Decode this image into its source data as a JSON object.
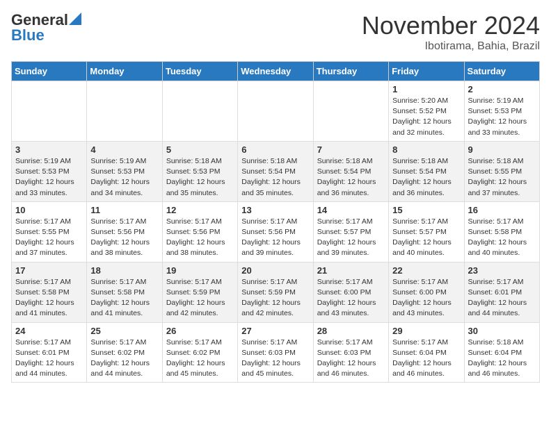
{
  "header": {
    "logo_line1": "General",
    "logo_line2": "Blue",
    "month": "November 2024",
    "location": "Ibotirama, Bahia, Brazil"
  },
  "weekdays": [
    "Sunday",
    "Monday",
    "Tuesday",
    "Wednesday",
    "Thursday",
    "Friday",
    "Saturday"
  ],
  "weeks": [
    [
      {
        "day": "",
        "info": ""
      },
      {
        "day": "",
        "info": ""
      },
      {
        "day": "",
        "info": ""
      },
      {
        "day": "",
        "info": ""
      },
      {
        "day": "",
        "info": ""
      },
      {
        "day": "1",
        "info": "Sunrise: 5:20 AM\nSunset: 5:52 PM\nDaylight: 12 hours\nand 32 minutes."
      },
      {
        "day": "2",
        "info": "Sunrise: 5:19 AM\nSunset: 5:53 PM\nDaylight: 12 hours\nand 33 minutes."
      }
    ],
    [
      {
        "day": "3",
        "info": "Sunrise: 5:19 AM\nSunset: 5:53 PM\nDaylight: 12 hours\nand 33 minutes."
      },
      {
        "day": "4",
        "info": "Sunrise: 5:19 AM\nSunset: 5:53 PM\nDaylight: 12 hours\nand 34 minutes."
      },
      {
        "day": "5",
        "info": "Sunrise: 5:18 AM\nSunset: 5:53 PM\nDaylight: 12 hours\nand 35 minutes."
      },
      {
        "day": "6",
        "info": "Sunrise: 5:18 AM\nSunset: 5:54 PM\nDaylight: 12 hours\nand 35 minutes."
      },
      {
        "day": "7",
        "info": "Sunrise: 5:18 AM\nSunset: 5:54 PM\nDaylight: 12 hours\nand 36 minutes."
      },
      {
        "day": "8",
        "info": "Sunrise: 5:18 AM\nSunset: 5:54 PM\nDaylight: 12 hours\nand 36 minutes."
      },
      {
        "day": "9",
        "info": "Sunrise: 5:18 AM\nSunset: 5:55 PM\nDaylight: 12 hours\nand 37 minutes."
      }
    ],
    [
      {
        "day": "10",
        "info": "Sunrise: 5:17 AM\nSunset: 5:55 PM\nDaylight: 12 hours\nand 37 minutes."
      },
      {
        "day": "11",
        "info": "Sunrise: 5:17 AM\nSunset: 5:56 PM\nDaylight: 12 hours\nand 38 minutes."
      },
      {
        "day": "12",
        "info": "Sunrise: 5:17 AM\nSunset: 5:56 PM\nDaylight: 12 hours\nand 38 minutes."
      },
      {
        "day": "13",
        "info": "Sunrise: 5:17 AM\nSunset: 5:56 PM\nDaylight: 12 hours\nand 39 minutes."
      },
      {
        "day": "14",
        "info": "Sunrise: 5:17 AM\nSunset: 5:57 PM\nDaylight: 12 hours\nand 39 minutes."
      },
      {
        "day": "15",
        "info": "Sunrise: 5:17 AM\nSunset: 5:57 PM\nDaylight: 12 hours\nand 40 minutes."
      },
      {
        "day": "16",
        "info": "Sunrise: 5:17 AM\nSunset: 5:58 PM\nDaylight: 12 hours\nand 40 minutes."
      }
    ],
    [
      {
        "day": "17",
        "info": "Sunrise: 5:17 AM\nSunset: 5:58 PM\nDaylight: 12 hours\nand 41 minutes."
      },
      {
        "day": "18",
        "info": "Sunrise: 5:17 AM\nSunset: 5:58 PM\nDaylight: 12 hours\nand 41 minutes."
      },
      {
        "day": "19",
        "info": "Sunrise: 5:17 AM\nSunset: 5:59 PM\nDaylight: 12 hours\nand 42 minutes."
      },
      {
        "day": "20",
        "info": "Sunrise: 5:17 AM\nSunset: 5:59 PM\nDaylight: 12 hours\nand 42 minutes."
      },
      {
        "day": "21",
        "info": "Sunrise: 5:17 AM\nSunset: 6:00 PM\nDaylight: 12 hours\nand 43 minutes."
      },
      {
        "day": "22",
        "info": "Sunrise: 5:17 AM\nSunset: 6:00 PM\nDaylight: 12 hours\nand 43 minutes."
      },
      {
        "day": "23",
        "info": "Sunrise: 5:17 AM\nSunset: 6:01 PM\nDaylight: 12 hours\nand 44 minutes."
      }
    ],
    [
      {
        "day": "24",
        "info": "Sunrise: 5:17 AM\nSunset: 6:01 PM\nDaylight: 12 hours\nand 44 minutes."
      },
      {
        "day": "25",
        "info": "Sunrise: 5:17 AM\nSunset: 6:02 PM\nDaylight: 12 hours\nand 44 minutes."
      },
      {
        "day": "26",
        "info": "Sunrise: 5:17 AM\nSunset: 6:02 PM\nDaylight: 12 hours\nand 45 minutes."
      },
      {
        "day": "27",
        "info": "Sunrise: 5:17 AM\nSunset: 6:03 PM\nDaylight: 12 hours\nand 45 minutes."
      },
      {
        "day": "28",
        "info": "Sunrise: 5:17 AM\nSunset: 6:03 PM\nDaylight: 12 hours\nand 46 minutes."
      },
      {
        "day": "29",
        "info": "Sunrise: 5:17 AM\nSunset: 6:04 PM\nDaylight: 12 hours\nand 46 minutes."
      },
      {
        "day": "30",
        "info": "Sunrise: 5:18 AM\nSunset: 6:04 PM\nDaylight: 12 hours\nand 46 minutes."
      }
    ]
  ]
}
